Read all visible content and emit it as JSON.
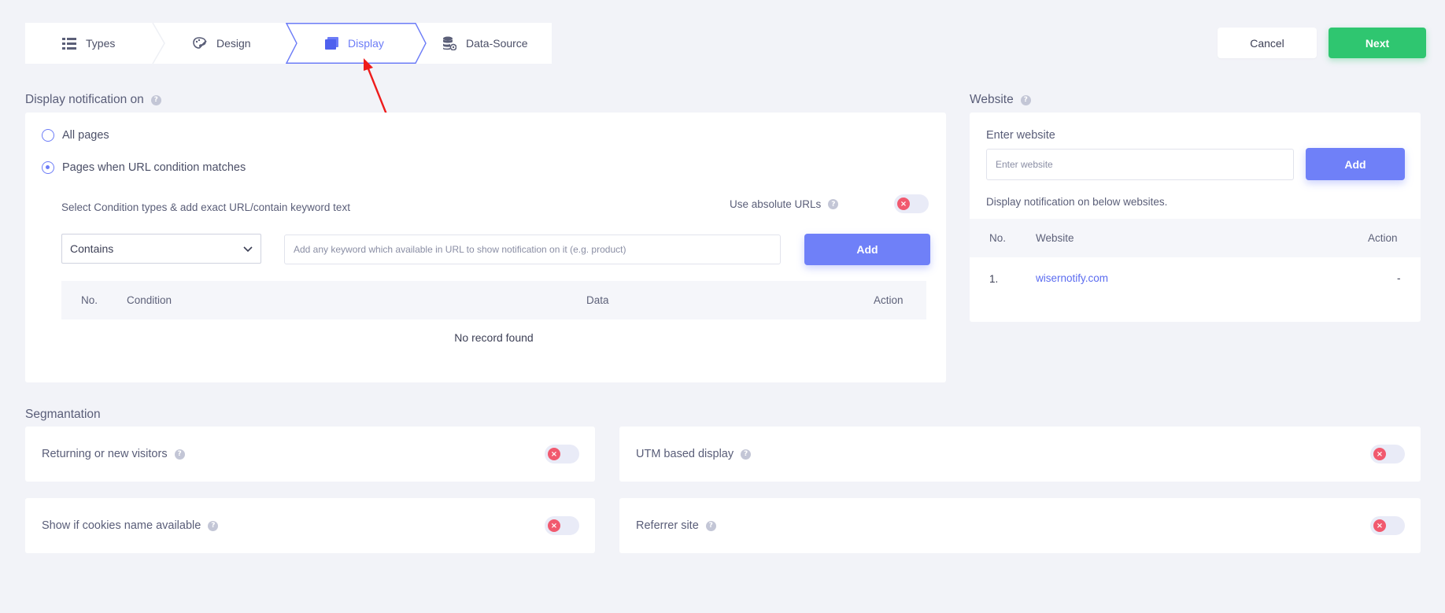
{
  "stepper": {
    "steps": [
      {
        "label": "Types",
        "icon": "list-icon"
      },
      {
        "label": "Design",
        "icon": "palette-icon"
      },
      {
        "label": "Display",
        "icon": "display-icon",
        "active": true
      },
      {
        "label": "Data-Source",
        "icon": "database-icon"
      }
    ]
  },
  "actions": {
    "cancel": "Cancel",
    "next": "Next"
  },
  "display": {
    "title": "Display notification on",
    "options": [
      {
        "label": "All pages",
        "checked": false
      },
      {
        "label": "Pages when URL condition matches",
        "checked": true
      }
    ],
    "condition_hint": "Select Condition types & add exact URL/contain keyword text",
    "absolute_urls_label": "Use absolute URLs",
    "condition_select_value": "Contains",
    "keyword_placeholder": "Add any keyword which available in URL to show notification on it (e.g. product)",
    "add_label": "Add",
    "table": {
      "columns": [
        "No.",
        "Condition",
        "Data",
        "Action"
      ],
      "empty": "No record found"
    }
  },
  "website": {
    "title": "Website",
    "field_label": "Enter website",
    "placeholder": "Enter website",
    "add_label": "Add",
    "hint": "Display notification on below websites.",
    "table": {
      "columns": [
        "No.",
        "Website",
        "Action"
      ],
      "rows": [
        {
          "no": "1.",
          "website": "wisernotify.com",
          "action": "-"
        }
      ]
    }
  },
  "segmentation": {
    "title": "Segmantation",
    "items": [
      {
        "label": "Returning or new visitors"
      },
      {
        "label": "UTM based display"
      },
      {
        "label": "Show if cookies name available"
      },
      {
        "label": "Referrer site"
      }
    ]
  },
  "colors": {
    "accent": "#6c7cf7",
    "success": "#2fc670",
    "danger": "#f1596e",
    "background": "#f2f3f8",
    "annotation_arrow": "#ee1c1c"
  }
}
